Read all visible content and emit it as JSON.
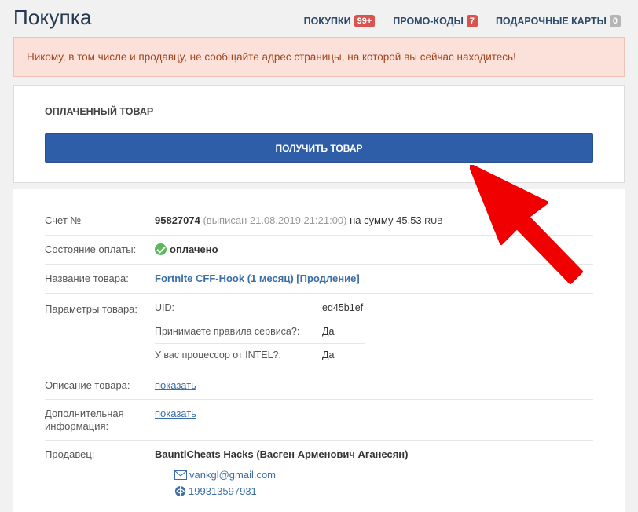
{
  "header": {
    "title": "Покупка",
    "nav": [
      {
        "label": "ПОКУПКИ",
        "badge": "99+",
        "badge_color": "#d9534f"
      },
      {
        "label": "ПРОМО-КОДЫ",
        "badge": "7",
        "badge_color": "#d9534f"
      },
      {
        "label": "ПОДАРОЧНЫЕ КАРТЫ",
        "badge": "0",
        "badge_color": "#b5b5b5"
      }
    ]
  },
  "alert": {
    "text": "Никому, в том числе и продавцу, не сообщайте адрес страницы, на которой вы сейчас находитесь!"
  },
  "paid_panel": {
    "title": "ОПЛАЧЕННЫЙ ТОВАР",
    "button_label": "ПОЛУЧИТЬ ТОВАР"
  },
  "details": {
    "invoice": {
      "label": "Счет №",
      "number": "95827074",
      "issued": "(выписан 21.08.2019 21:21:00)",
      "sum_text": "на сумму 45,53",
      "currency": "RUB"
    },
    "payment_status": {
      "label": "Состояние оплаты:",
      "value": "оплачено",
      "icon": "check-circle-icon"
    },
    "product_name": {
      "label": "Название товара:",
      "value": "Fortnite CFF-Hook (1 месяц) [Продление]"
    },
    "params": {
      "label": "Параметры товара:",
      "rows": [
        {
          "name": "UID:",
          "value": "ed45b1ef"
        },
        {
          "name": "Принимаете правила сервиса?:",
          "value": "Да"
        },
        {
          "name": "У вас процессор от INTEL?:",
          "value": "Да"
        }
      ]
    },
    "description": {
      "label": "Описание товара:",
      "link": "показать"
    },
    "extra_info": {
      "label_line1": "Дополнительная",
      "label_line2": "информация:",
      "link": "показать"
    },
    "seller": {
      "label": "Продавец:",
      "name": "BauntiCheats Hacks (Васген Арменович Аганесян)",
      "email": "vankgl@gmail.com",
      "wmid": "199313597931"
    }
  },
  "annotation": {
    "arrow_color": "#f00000"
  }
}
